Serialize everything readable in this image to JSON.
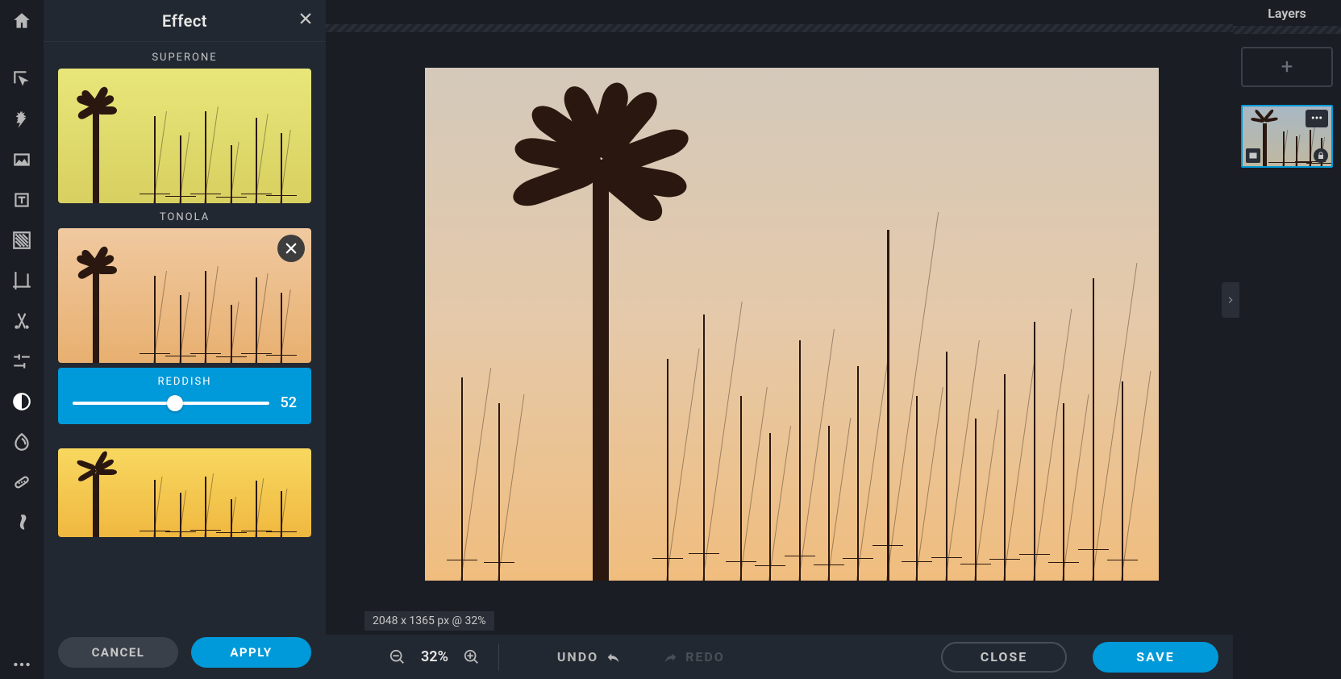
{
  "panel": {
    "title": "Effect"
  },
  "effects": {
    "items": [
      {
        "label": "SUPERONE",
        "skin": "superone",
        "selected": false
      },
      {
        "label": "TONOLA",
        "skin": "tonola",
        "selected": true
      },
      {
        "label": "",
        "skin": "yellow",
        "selected": false
      }
    ],
    "intensity": {
      "label": "REDDISH",
      "value": 52
    }
  },
  "footer": {
    "cancel": "CANCEL",
    "apply": "APPLY"
  },
  "status": "2048 x 1365 px @ 32%",
  "bottombar": {
    "zoom": "32%",
    "undo": "UNDO",
    "redo": "REDO",
    "close": "CLOSE",
    "save": "SAVE"
  },
  "layers": {
    "title": "Layers",
    "add": "+",
    "more": "•••"
  },
  "colors": {
    "accent": "#0099d9"
  }
}
